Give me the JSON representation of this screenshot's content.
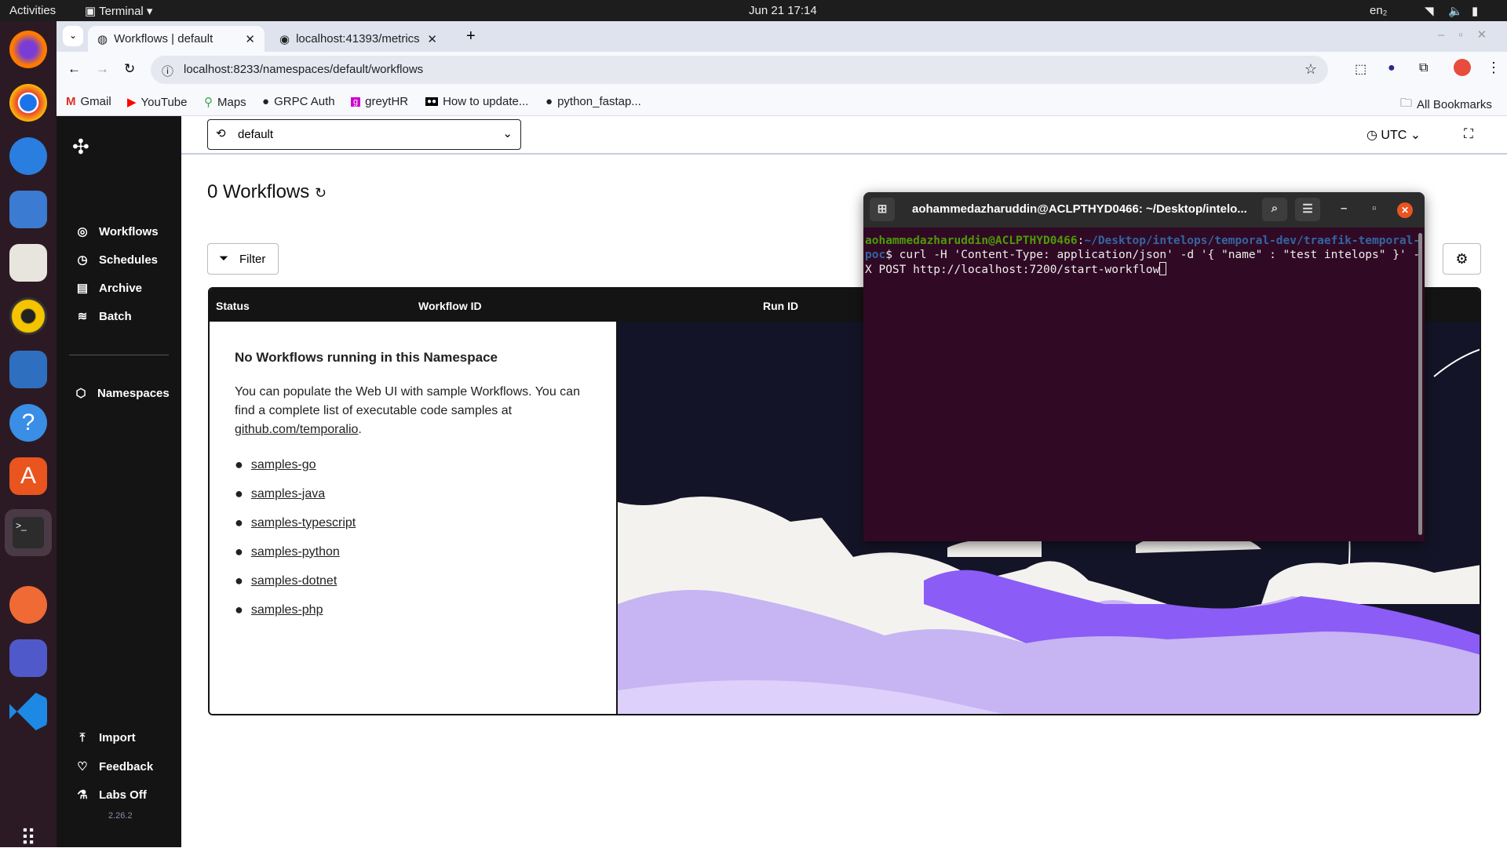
{
  "system_bar": {
    "activities": "Activities",
    "app": "Terminal",
    "datetime": "Jun 21  17:14",
    "lang": "en₂"
  },
  "browser": {
    "tabs": [
      {
        "title": "Workflows | default",
        "active": true
      },
      {
        "title": "localhost:41393/metrics",
        "active": false
      }
    ],
    "url": "localhost:8233/namespaces/default/workflows",
    "bookmarks": [
      "Gmail",
      "YouTube",
      "Maps",
      "GRPC Auth",
      "greytHR",
      "How to update...",
      "python_fastap..."
    ],
    "all_bookmarks": "All Bookmarks"
  },
  "sidebar": {
    "items": [
      {
        "label": "Workflows",
        "icon": "workflows-icon"
      },
      {
        "label": "Schedules",
        "icon": "schedules-icon"
      },
      {
        "label": "Archive",
        "icon": "archive-icon"
      },
      {
        "label": "Batch",
        "icon": "batch-icon"
      }
    ],
    "namespaces": "Namespaces",
    "bottom": [
      {
        "label": "Import",
        "icon": "upload-icon"
      },
      {
        "label": "Feedback",
        "icon": "heart-icon"
      },
      {
        "label": "Labs Off",
        "icon": "flask-icon"
      }
    ],
    "version": "2.26.2"
  },
  "header": {
    "namespace": "default",
    "timezone": "UTC"
  },
  "main": {
    "title": "0 Workflows",
    "filter": "Filter",
    "columns": [
      "Status",
      "Workflow ID",
      "Run ID"
    ],
    "empty": {
      "heading": "No Workflows running in this Namespace",
      "text": "You can populate the Web UI with sample Workflows. You can find a complete list of executable code samples at",
      "link": "github.com/temporalio",
      "period": ".",
      "samples": [
        "samples-go",
        "samples-java",
        "samples-typescript",
        "samples-python",
        "samples-dotnet",
        "samples-php"
      ]
    }
  },
  "terminal": {
    "title": "aohammedazharuddin@ACLPTHYD0466: ~/Desktop/intelo...",
    "user_host": "aohammedazharuddin@ACLPTHYD0466",
    "path": "~/Desktop/intelops/temporal-dev/traefik-temporal-poc",
    "command": "curl -H 'Content-Type: application/json' -d '{ \"name\" : \"test intelops\" }' -X POST http://localhost:7200/start-workflow"
  },
  "colors": {
    "sidebar": "#141414",
    "terminal_bg": "#300a24",
    "accent_purple": "#8b5cf6"
  }
}
